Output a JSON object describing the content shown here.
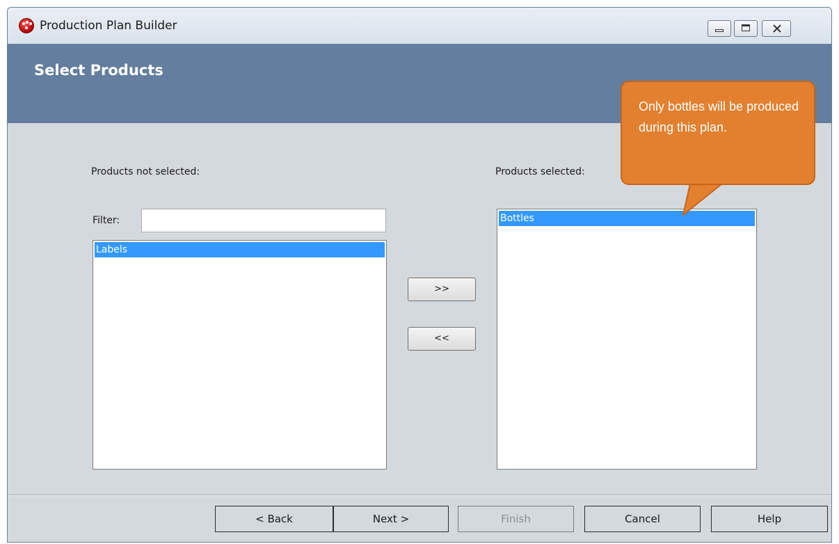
{
  "window": {
    "title": "Production Plan Builder"
  },
  "header": {
    "title": "Select Products"
  },
  "left_panel": {
    "label": "Products not selected:",
    "filter_label": "Filter:",
    "filter_value": "",
    "filter_placeholder": "",
    "items": [
      "Labels"
    ],
    "selected_item": "Labels"
  },
  "right_panel": {
    "label": "Products selected:",
    "items": [
      "Bottles"
    ],
    "selected_item": "Bottles"
  },
  "transfer": {
    "add_label": ">>",
    "remove_label": "<<"
  },
  "footer": {
    "back_label": "< Back",
    "next_label": "Next >",
    "finish_label": "Finish",
    "cancel_label": "Cancel",
    "help_label": "Help",
    "finish_enabled": false
  },
  "callout": {
    "text": "Only bottles will be produced during this plan."
  },
  "colors": {
    "header_bg": "#637e9e",
    "window_bg": "#d4d9de",
    "selection": "#3399ff",
    "callout_bg": "#e2802f",
    "app_icon": "#cc0000"
  },
  "icons": {
    "app": "app-logo-icon",
    "minimize": "minimize-icon",
    "maximize": "maximize-icon",
    "close": "close-icon"
  }
}
